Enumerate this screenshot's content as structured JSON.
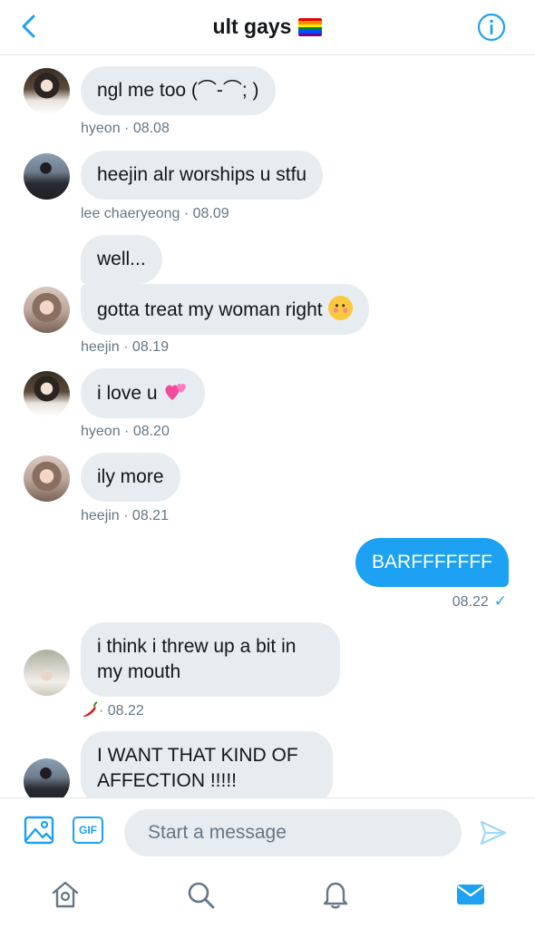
{
  "header": {
    "title": "ult gays",
    "back_icon": "chevron-left-icon",
    "info_icon": "info-icon",
    "flag_emoji": "rainbow-flag"
  },
  "messages": [
    {
      "text": "ngl me too (⌒-⌒; )",
      "meta": "hyeon · 08.08",
      "avatar": "hyeon"
    },
    {
      "text": "heejin alr worships u stfu",
      "meta": "lee chaeryeong · 08.09",
      "avatar": "lee chaeryeong"
    },
    {
      "text": "well...",
      "avatar": "heejin"
    },
    {
      "text": "gotta treat my woman right",
      "emoji": "smiling-face-with-hearts",
      "meta": "heejin · 08.19",
      "avatar": "heejin"
    },
    {
      "text": "i love u",
      "emoji": "two-hearts",
      "meta": "hyeon · 08.20",
      "avatar": "hyeon"
    },
    {
      "text": "ily more",
      "meta": "heejin · 08.21",
      "avatar": "heejin"
    },
    {
      "text": "BARFFFFFFF",
      "meta": "08.22",
      "sent": true
    },
    {
      "text": "i think i threw up a bit in my mouth",
      "meta": "· 08.22",
      "meta_emoji": "hot-pepper",
      "avatar": "pepper"
    },
    {
      "text": "I WANT THAT KIND OF AFFECTION !!!!!",
      "avatar": "lee chaeryeong"
    }
  ],
  "composer": {
    "placeholder": "Start a message",
    "gif_label": "GIF"
  },
  "tabs": [
    "home-icon",
    "search-icon",
    "bell-icon",
    "mail-icon"
  ],
  "colors": {
    "accent": "#1da1f2",
    "bubble_received": "#e6ecf0",
    "meta_text": "#657786"
  }
}
